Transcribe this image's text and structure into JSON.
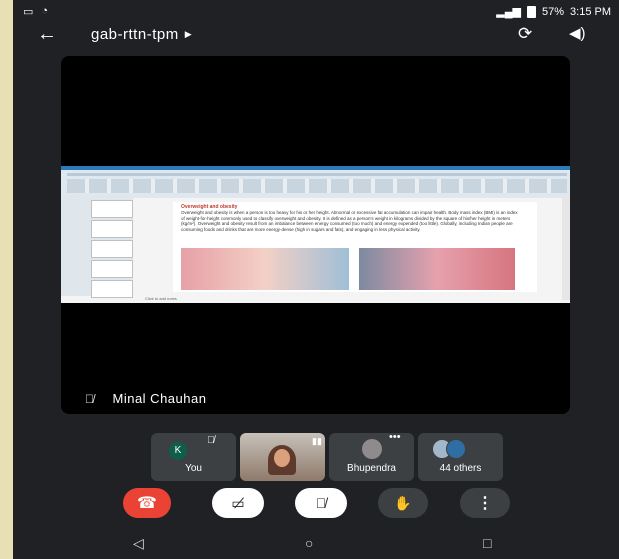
{
  "statusbar": {
    "signal_icon": "signal-icon",
    "battery": "57%",
    "time": "3:15 PM"
  },
  "header": {
    "meeting_code": "gab-rttn-tpm",
    "back_icon": "back-arrow-icon",
    "switch_camera_icon": "switch-camera-icon",
    "audio_output_icon": "speaker-icon"
  },
  "main": {
    "presenter_name": "Minal Chauhan",
    "slide": {
      "heading": "Overweight and obesity",
      "body": "Overweight and obesity is when a person is too heavy for his or her height. Abnormal or excessive fat accumulation can impair health. Body mass index (BMI) is an index of weight-for-height commonly used to classify overweight and obesity. It is defined as a person's weight in kilograms divided by the square of his/her height in meters (kg/m²). Overweight and obesity result from an imbalance between energy consumed (too much) and energy expended (too little). Globally, including Indian people are consuming foods and drinks that are more energy-dense (high in sugars and fats), and engaging in less physical activity.",
      "notes": "Click to add notes"
    }
  },
  "participants": [
    {
      "label": "You",
      "initial": "K"
    },
    {
      "label": ""
    },
    {
      "label": "Bhupendra"
    },
    {
      "label": "44 others"
    }
  ],
  "controls": {
    "end_call_icon": "end-call-icon",
    "camera_icon": "camera-off-icon",
    "mic_icon": "mic-off-icon",
    "raise_hand_icon": "raise-hand-icon",
    "more_icon": "more-options-icon"
  }
}
